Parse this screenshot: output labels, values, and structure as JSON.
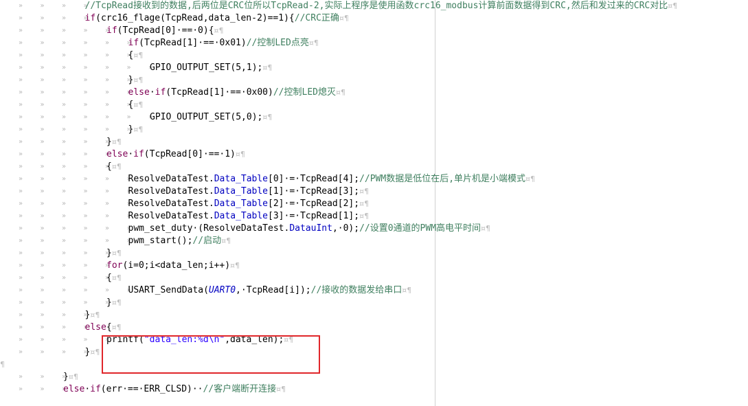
{
  "editor": {
    "tab_mark": "»",
    "space_mark": "·",
    "eol_mark": "¤¶",
    "lines": [
      {
        "indent": 4,
        "tokens": [
          {
            "t": "cmt",
            "v": "//TcpRead接收到的数据,后两位是CRC位所以TcpRead-2,实际上程序是使用函数crc16_modbus计算前面数据得到CRC,然后和发过来的CRC对比"
          },
          {
            "t": "mark",
            "v": "¤¶"
          }
        ]
      },
      {
        "indent": 4,
        "tokens": [
          {
            "t": "kw",
            "v": "if"
          },
          {
            "t": "plain",
            "v": "(crc16_flage(TcpRead,data_len-2)==1){"
          },
          {
            "t": "cmt",
            "v": "//CRC正确"
          },
          {
            "t": "mark",
            "v": "¤¶"
          }
        ]
      },
      {
        "indent": 5,
        "tokens": [
          {
            "t": "kw",
            "v": "if"
          },
          {
            "t": "plain",
            "v": "(TcpRead[0]·==·0){"
          },
          {
            "t": "mark",
            "v": "¤¶"
          }
        ]
      },
      {
        "indent": 6,
        "tokens": [
          {
            "t": "kw",
            "v": "if"
          },
          {
            "t": "plain",
            "v": "(TcpRead[1]·==·0x01)"
          },
          {
            "t": "cmt",
            "v": "//控制LED点亮"
          },
          {
            "t": "mark",
            "v": "¤¶"
          }
        ]
      },
      {
        "indent": 6,
        "tokens": [
          {
            "t": "plain",
            "v": "{"
          },
          {
            "t": "mark",
            "v": "¤¶"
          }
        ]
      },
      {
        "indent": 7,
        "tokens": [
          {
            "t": "plain",
            "v": "GPIO_OUTPUT_SET(5,1);"
          },
          {
            "t": "mark",
            "v": "¤¶"
          }
        ]
      },
      {
        "indent": 6,
        "tokens": [
          {
            "t": "plain",
            "v": "}"
          },
          {
            "t": "mark",
            "v": "¤¶"
          }
        ]
      },
      {
        "indent": 6,
        "tokens": [
          {
            "t": "kw",
            "v": "else"
          },
          {
            "t": "plain",
            "v": "·"
          },
          {
            "t": "kw",
            "v": "if"
          },
          {
            "t": "plain",
            "v": "(TcpRead[1]·==·0x00)"
          },
          {
            "t": "cmt",
            "v": "//控制LED熄灭"
          },
          {
            "t": "mark",
            "v": "¤¶"
          }
        ]
      },
      {
        "indent": 6,
        "tokens": [
          {
            "t": "plain",
            "v": "{"
          },
          {
            "t": "mark",
            "v": "¤¶"
          }
        ]
      },
      {
        "indent": 7,
        "tokens": [
          {
            "t": "plain",
            "v": "GPIO_OUTPUT_SET(5,0);"
          },
          {
            "t": "mark",
            "v": "¤¶"
          }
        ]
      },
      {
        "indent": 6,
        "tokens": [
          {
            "t": "plain",
            "v": "}"
          },
          {
            "t": "mark",
            "v": "¤¶"
          }
        ]
      },
      {
        "indent": 5,
        "tokens": [
          {
            "t": "plain",
            "v": "}"
          },
          {
            "t": "mark",
            "v": "¤¶"
          }
        ]
      },
      {
        "indent": 5,
        "tokens": [
          {
            "t": "kw",
            "v": "else"
          },
          {
            "t": "plain",
            "v": "·"
          },
          {
            "t": "kw",
            "v": "if"
          },
          {
            "t": "plain",
            "v": "(TcpRead[0]·==·1)"
          },
          {
            "t": "mark",
            "v": "¤¶"
          }
        ]
      },
      {
        "indent": 5,
        "tokens": [
          {
            "t": "plain",
            "v": "{"
          },
          {
            "t": "mark",
            "v": "¤¶"
          }
        ]
      },
      {
        "indent": 6,
        "tokens": [
          {
            "t": "plain",
            "v": "ResolveDataTest."
          },
          {
            "t": "field",
            "v": "Data_Table"
          },
          {
            "t": "plain",
            "v": "[0]·=·TcpRead[4];"
          },
          {
            "t": "cmt",
            "v": "//PWM数据是低位在后,单片机是小端模式"
          },
          {
            "t": "mark",
            "v": "¤¶"
          }
        ]
      },
      {
        "indent": 6,
        "tokens": [
          {
            "t": "plain",
            "v": "ResolveDataTest."
          },
          {
            "t": "field",
            "v": "Data_Table"
          },
          {
            "t": "plain",
            "v": "[1]·=·TcpRead[3];"
          },
          {
            "t": "mark",
            "v": "¤¶"
          }
        ]
      },
      {
        "indent": 6,
        "tokens": [
          {
            "t": "plain",
            "v": "ResolveDataTest."
          },
          {
            "t": "field",
            "v": "Data_Table"
          },
          {
            "t": "plain",
            "v": "[2]·=·TcpRead[2];"
          },
          {
            "t": "mark",
            "v": "¤¶"
          }
        ]
      },
      {
        "indent": 6,
        "tokens": [
          {
            "t": "plain",
            "v": "ResolveDataTest."
          },
          {
            "t": "field",
            "v": "Data_Table"
          },
          {
            "t": "plain",
            "v": "[3]·=·TcpRead[1];"
          },
          {
            "t": "mark",
            "v": "¤¶"
          }
        ]
      },
      {
        "indent": 6,
        "tokens": [
          {
            "t": "plain",
            "v": "pwm_set_duty·(ResolveDataTest."
          },
          {
            "t": "field",
            "v": "DatauInt"
          },
          {
            "t": "plain",
            "v": ",·0);"
          },
          {
            "t": "cmt",
            "v": "//设置0通道的PWM高电平时间"
          },
          {
            "t": "mark",
            "v": "¤¶"
          }
        ]
      },
      {
        "indent": 6,
        "tokens": [
          {
            "t": "plain",
            "v": "pwm_start();"
          },
          {
            "t": "cmt",
            "v": "//启动"
          },
          {
            "t": "mark",
            "v": "¤¶"
          }
        ]
      },
      {
        "indent": 5,
        "tokens": [
          {
            "t": "plain",
            "v": "}"
          },
          {
            "t": "mark",
            "v": "¤¶"
          }
        ]
      },
      {
        "indent": 5,
        "tokens": [
          {
            "t": "kw",
            "v": "for"
          },
          {
            "t": "plain",
            "v": "(i=0;i<data_len;i++)"
          },
          {
            "t": "mark",
            "v": "¤¶"
          }
        ]
      },
      {
        "indent": 5,
        "tokens": [
          {
            "t": "plain",
            "v": "{"
          },
          {
            "t": "mark",
            "v": "¤¶"
          }
        ]
      },
      {
        "indent": 6,
        "tokens": [
          {
            "t": "plain",
            "v": "USART_SendData("
          },
          {
            "t": "const",
            "v": "UART0"
          },
          {
            "t": "plain",
            "v": ",·TcpRead[i]);"
          },
          {
            "t": "cmt",
            "v": "//接收的数据发给串口"
          },
          {
            "t": "mark",
            "v": "¤¶"
          }
        ]
      },
      {
        "indent": 5,
        "tokens": [
          {
            "t": "plain",
            "v": "}"
          },
          {
            "t": "mark",
            "v": "¤¶"
          }
        ]
      },
      {
        "indent": 4,
        "tokens": [
          {
            "t": "plain",
            "v": "}"
          },
          {
            "t": "mark",
            "v": "¤¶"
          }
        ]
      },
      {
        "indent": 4,
        "tokens": [
          {
            "t": "kw",
            "v": "else"
          },
          {
            "t": "plain",
            "v": "{"
          },
          {
            "t": "mark",
            "v": "¤¶"
          }
        ]
      },
      {
        "indent": 5,
        "tokens": [
          {
            "t": "plain",
            "v": "printf("
          },
          {
            "t": "str",
            "v": "\"data_len:%d\\n\""
          },
          {
            "t": "plain",
            "v": ",data_len);"
          },
          {
            "t": "mark",
            "v": "¤¶"
          }
        ]
      },
      {
        "indent": 4,
        "tokens": [
          {
            "t": "plain",
            "v": "}"
          },
          {
            "t": "mark",
            "v": "¤¶"
          }
        ]
      },
      {
        "indent": 0,
        "tokens": [
          {
            "t": "mark",
            "v": "¶"
          }
        ]
      },
      {
        "indent": 3,
        "tokens": [
          {
            "t": "plain",
            "v": "}"
          },
          {
            "t": "mark",
            "v": "¤¶"
          }
        ]
      },
      {
        "indent": 3,
        "tokens": [
          {
            "t": "kw",
            "v": "else"
          },
          {
            "t": "plain",
            "v": "·"
          },
          {
            "t": "kw",
            "v": "if"
          },
          {
            "t": "plain",
            "v": "(err·==·ERR_CLSD)··"
          },
          {
            "t": "cmt",
            "v": "//客户端断开连接"
          },
          {
            "t": "mark",
            "v": "¤¶"
          }
        ]
      }
    ]
  }
}
